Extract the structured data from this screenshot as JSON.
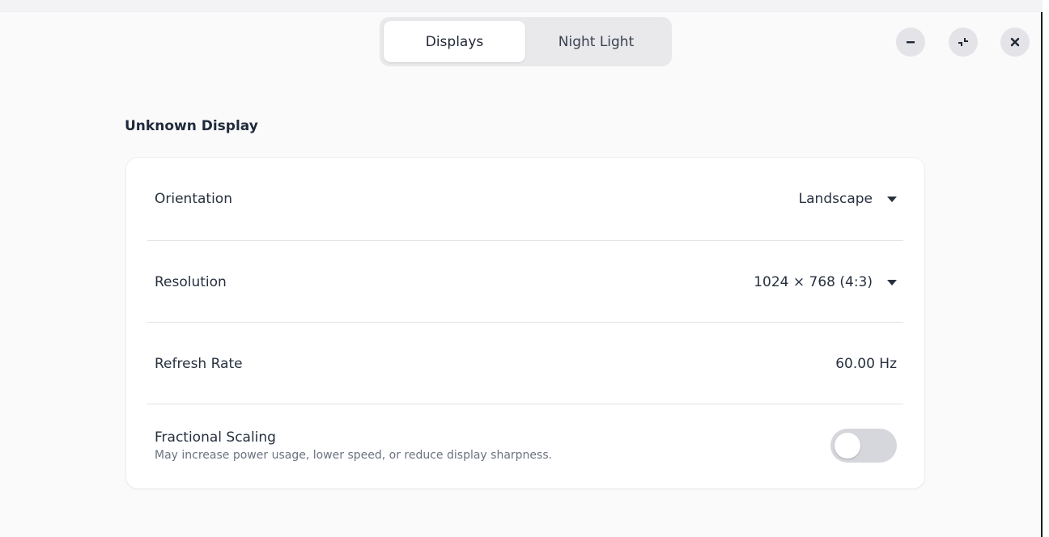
{
  "header": {
    "tabs": [
      {
        "label": "Displays",
        "active": true
      },
      {
        "label": "Night Light",
        "active": false
      }
    ],
    "controls": [
      "minimize-icon",
      "restore-icon",
      "close-icon"
    ]
  },
  "display": {
    "title": "Unknown Display",
    "orientation": {
      "label": "Orientation",
      "value": "Landscape"
    },
    "resolution": {
      "label": "Resolution",
      "value": "1024 × 768 (4:3)"
    },
    "refresh_rate": {
      "label": "Refresh Rate",
      "value": "60.00 Hz"
    },
    "fractional_scaling": {
      "label": "Fractional Scaling",
      "description": "May increase power usage, lower speed, or reduce display sharpness.",
      "enabled": false
    }
  },
  "colors": {
    "toggle_off": "#d6d7dc",
    "card": "#ffffff",
    "background": "#fafafb"
  }
}
